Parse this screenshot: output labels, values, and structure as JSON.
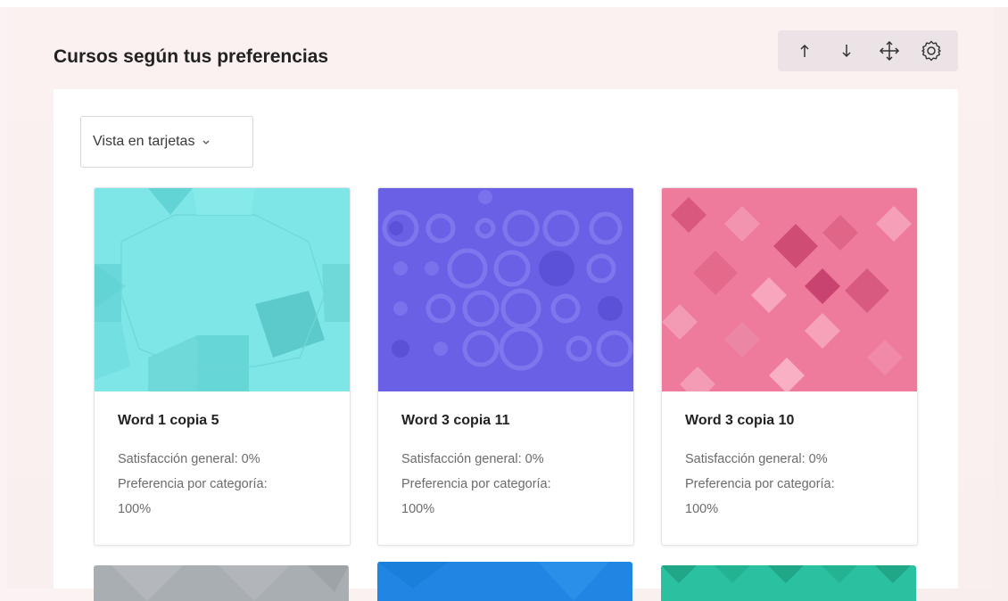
{
  "block": {
    "title": "Cursos según tus preferencias",
    "controls": [
      {
        "icon": "arrow-up-icon"
      },
      {
        "icon": "arrow-down-icon"
      },
      {
        "icon": "move-icon"
      },
      {
        "icon": "gear-icon"
      }
    ]
  },
  "view_select": {
    "label": "Vista en tarjetas"
  },
  "courses": [
    {
      "title": "Word 1 copia 5",
      "satisfaction": "Satisfacción general: 0%",
      "preference": "Preferencia por categoría:",
      "preference_value": "100%",
      "color": "#7fe6e8"
    },
    {
      "title": "Word 3 copia 11",
      "satisfaction": "Satisfacción general: 0%",
      "preference": "Preferencia por categoría:",
      "preference_value": "100%",
      "color": "#6a60e6"
    },
    {
      "title": "Word 3 copia 10",
      "satisfaction": "Satisfacción general: 0%",
      "preference": "Preferencia por categoría:",
      "preference_value": "100%",
      "color": "#ee7a9c"
    }
  ],
  "next_row_colors": [
    "#a9aeb3",
    "#1f86e3",
    "#2bc1a0"
  ]
}
